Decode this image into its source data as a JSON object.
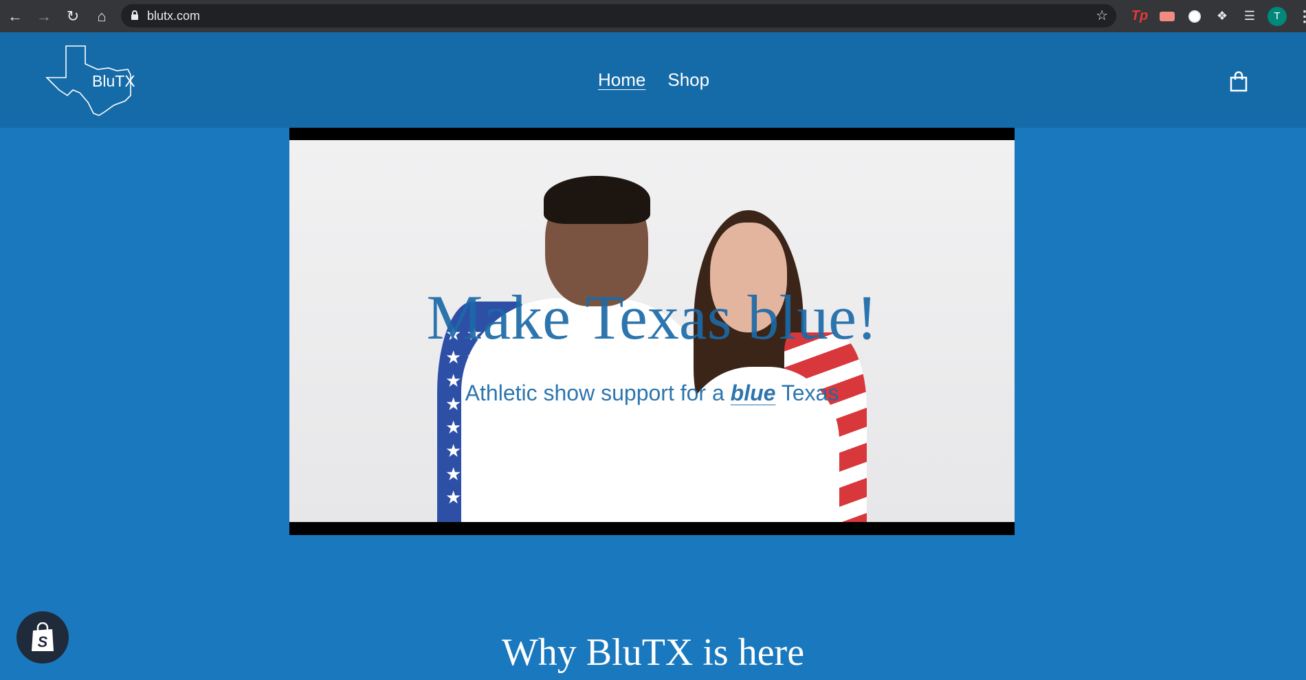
{
  "browser": {
    "url": "blutx.com",
    "profile_initial": "T",
    "extensions": [
      "tp-extension-icon",
      "record-extension-icon",
      "circle-extension-icon",
      "puzzle-icon",
      "media-queue-icon"
    ]
  },
  "header": {
    "logo_text": "BluTX",
    "nav": [
      {
        "label": "Home",
        "active": true
      },
      {
        "label": "Shop",
        "active": false
      }
    ]
  },
  "hero": {
    "title": "Make Texas blue!",
    "subtitle_prefix": "Athletic show support for a ",
    "subtitle_emphasis": "blue",
    "subtitle_suffix": " Texas"
  },
  "section": {
    "heading": "Why BluTX is here"
  },
  "colors": {
    "page_bg": "#1a78be",
    "header_bg": "#156ba8",
    "accent": "#1c6aa8"
  }
}
